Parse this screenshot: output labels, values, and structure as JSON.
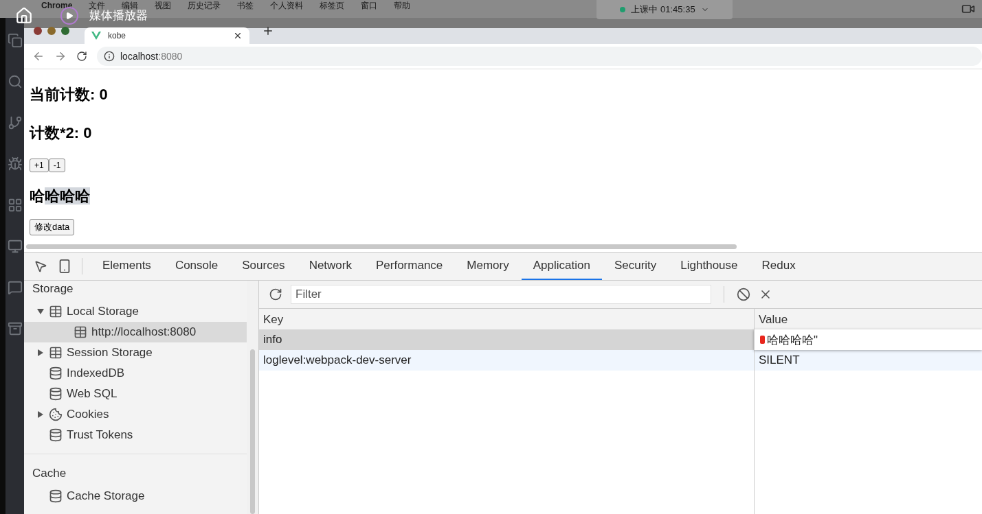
{
  "player": {
    "title": "媒体播放器"
  },
  "menu_bar": {
    "app_name": "Chrome",
    "items": [
      "文件",
      "编辑",
      "视图",
      "历史记录",
      "书签",
      "个人资料",
      "标签页",
      "窗口",
      "帮助"
    ],
    "session": {
      "label": "上课中 01:45:35",
      "color": "#1f9d6e"
    }
  },
  "browser": {
    "tabs": [
      {
        "title": "kobe",
        "selected": true
      }
    ],
    "address": {
      "host": "localhost",
      "port": ":8080"
    }
  },
  "page": {
    "count_heading": "当前计数: 0",
    "double_heading": "计数*2: 0",
    "buttons": [
      "+1",
      "-1"
    ],
    "message_heading": {
      "text": "哈",
      "selection": "哈哈哈"
    },
    "change_button": "修改data"
  },
  "devtools": {
    "tabs": [
      {
        "label": "Elements",
        "selected": false
      },
      {
        "label": "Console",
        "selected": false
      },
      {
        "label": "Sources",
        "selected": false
      },
      {
        "label": "Network",
        "selected": false
      },
      {
        "label": "Performance",
        "selected": false
      },
      {
        "label": "Memory",
        "selected": false
      },
      {
        "label": "Application",
        "selected": true
      },
      {
        "label": "Security",
        "selected": false
      },
      {
        "label": "Lighthouse",
        "selected": false
      },
      {
        "label": "Redux",
        "selected": false
      }
    ],
    "sidebar": {
      "sections": [
        {
          "title": "Storage",
          "items": [
            {
              "label": "Local Storage",
              "kind": "table",
              "expandable": true,
              "expanded": true,
              "selected": false,
              "children": [
                {
                  "label": "http://localhost:8080",
                  "kind": "table",
                  "expandable": false,
                  "selected": true
                }
              ]
            },
            {
              "label": "Session Storage",
              "kind": "table",
              "expandable": true,
              "expanded": false,
              "selected": false
            },
            {
              "label": "IndexedDB",
              "kind": "database",
              "expandable": false,
              "selected": false
            },
            {
              "label": "Web SQL",
              "kind": "database",
              "expandable": false,
              "selected": false
            },
            {
              "label": "Cookies",
              "kind": "cookie",
              "expandable": true,
              "expanded": false,
              "selected": false
            },
            {
              "label": "Trust Tokens",
              "kind": "database",
              "expandable": false,
              "selected": false
            }
          ]
        },
        {
          "title": "Cache",
          "items": [
            {
              "label": "Cache Storage",
              "kind": "database",
              "expandable": false,
              "selected": false
            }
          ]
        }
      ]
    },
    "filter": {
      "placeholder": "Filter"
    },
    "table": {
      "columns": [
        "Key",
        "Value"
      ],
      "rows": [
        {
          "key": "info",
          "value": "哈哈哈哈\"",
          "selected": true,
          "editing": true
        },
        {
          "key": "loglevel:webpack-dev-server",
          "value": "SILENT",
          "selected": false,
          "editing": false
        }
      ]
    }
  }
}
